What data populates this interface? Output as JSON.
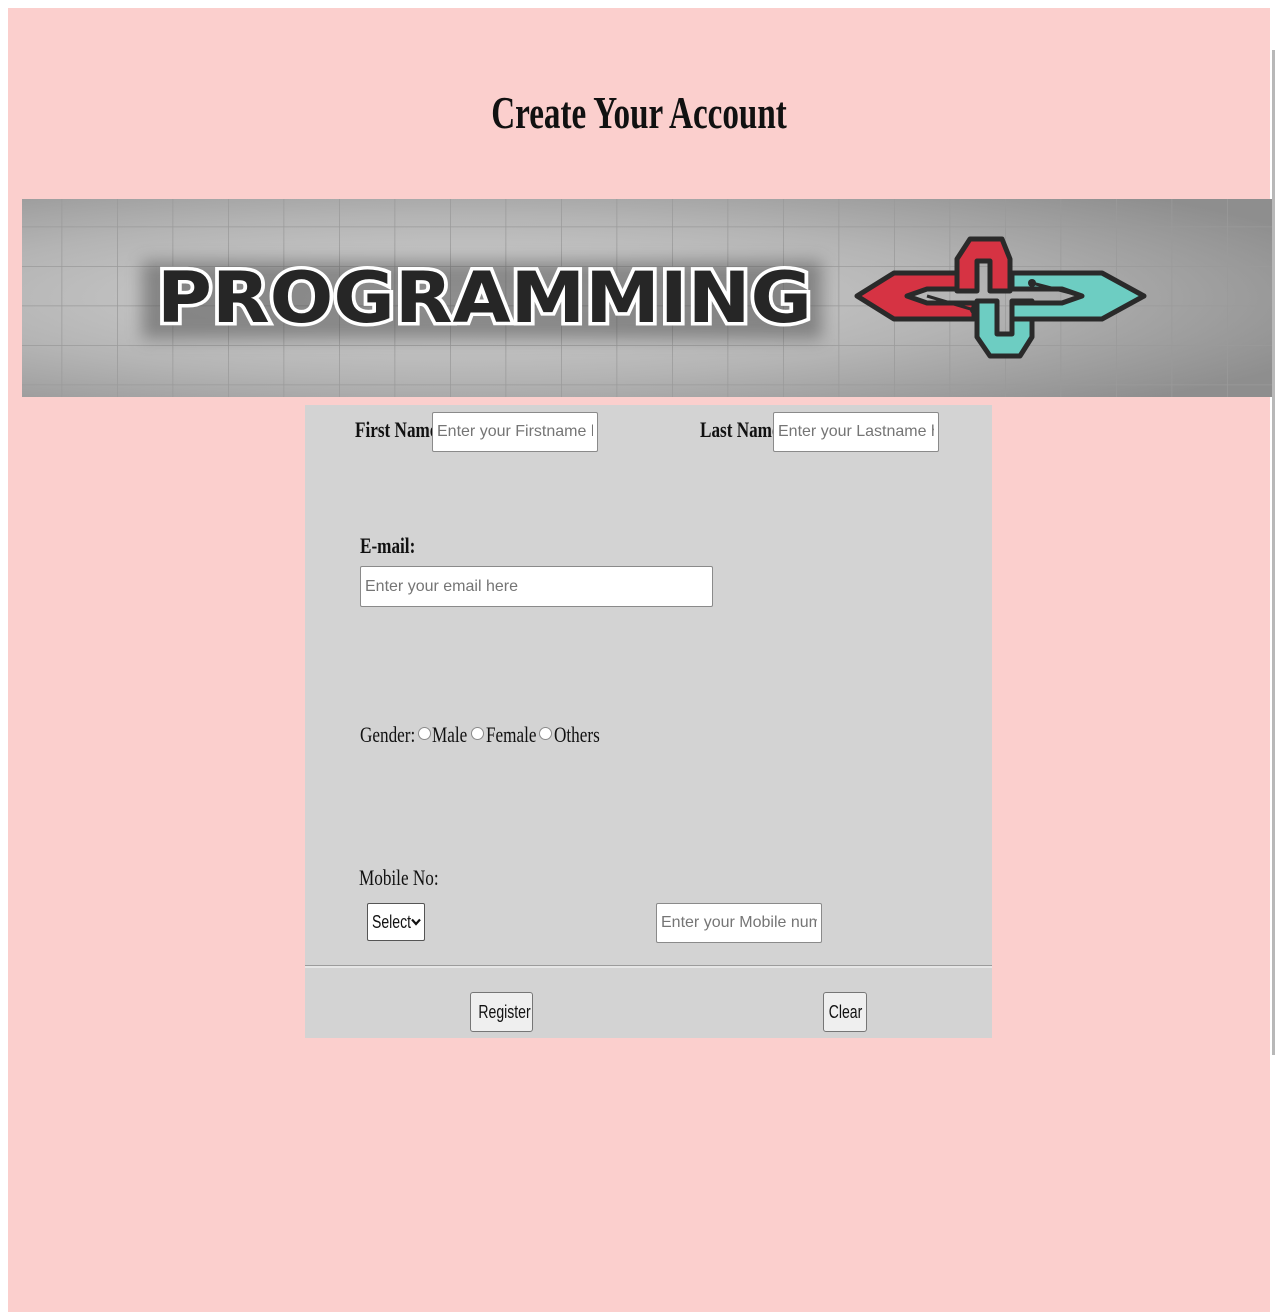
{
  "page": {
    "title": "Create Your Account"
  },
  "banner": {
    "text": "PROGRAMMING",
    "grid_color": "#9a9a9a",
    "logo_red": "#d63343",
    "logo_teal": "#6dcdc2"
  },
  "form": {
    "first_name": {
      "label": "First Name",
      "placeholder": "Enter your Firstname here"
    },
    "last_name": {
      "label": "Last Name",
      "placeholder": "Enter your Lastname here"
    },
    "email": {
      "label": "E-mail:",
      "placeholder": "Enter your email here"
    },
    "gender": {
      "label": "Gender:",
      "options": [
        "Male",
        "Female",
        "Others"
      ]
    },
    "mobile": {
      "label": "Mobile No:",
      "select_value": "Select",
      "placeholder": "Enter your Mobile number"
    },
    "register_label": "Register",
    "clear_label": "Clear"
  },
  "colors": {
    "page_background": "#fbcfcd",
    "form_background": "#d3d3d3"
  }
}
